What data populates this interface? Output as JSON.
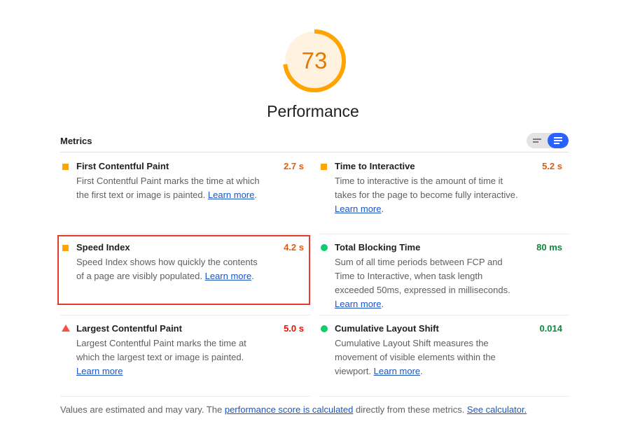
{
  "gauge": {
    "score": "73",
    "score_value": 73,
    "label": "Performance",
    "color": "#ffa400",
    "bg_color": "#fff3e0",
    "text_color": "#e67700"
  },
  "metrics": {
    "title": "Metrics",
    "toggle": {
      "left_icon": "compact-view-icon",
      "right_icon": "expanded-view-icon",
      "active": "expanded"
    },
    "items": [
      {
        "name": "First Contentful Paint",
        "value": "2.7 s",
        "status": "average",
        "icon": "orange-square-icon",
        "desc": "First Contentful Paint marks the time at which the first text or image is painted.",
        "link": "Learn more",
        "suffix": "."
      },
      {
        "name": "Time to Interactive",
        "value": "5.2 s",
        "status": "average",
        "icon": "orange-square-icon",
        "desc": "Time to interactive is the amount of time it takes for the page to become fully interactive.",
        "link": "Learn more",
        "suffix": "."
      },
      {
        "name": "Speed Index",
        "value": "4.2 s",
        "status": "average",
        "icon": "orange-square-icon",
        "desc": "Speed Index shows how quickly the contents of a page are visibly populated.",
        "link": "Learn more",
        "suffix": "."
      },
      {
        "name": "Total Blocking Time",
        "value": "80 ms",
        "status": "pass",
        "icon": "green-circle-icon",
        "desc": "Sum of all time periods between FCP and Time to Interactive, when task length exceeded 50ms, expressed in milliseconds.",
        "link": "Learn more",
        "suffix": "."
      },
      {
        "name": "Largest Contentful Paint",
        "value": "5.0 s",
        "status": "fail",
        "icon": "red-triangle-icon",
        "desc": "Largest Contentful Paint marks the time at which the largest text or image is painted.",
        "link": "Learn more",
        "suffix": ""
      },
      {
        "name": "Cumulative Layout Shift",
        "value": "0.014",
        "status": "pass",
        "icon": "green-circle-icon",
        "desc": "Cumulative Layout Shift measures the movement of visible elements within the viewport.",
        "link": "Learn more",
        "suffix": "."
      }
    ]
  },
  "footer": {
    "text1": "Values are estimated and may vary. The ",
    "link1": "performance score is calculated",
    "text2": " directly from these metrics. ",
    "link2": "See calculator."
  },
  "colors": {
    "average": "#ffa400",
    "pass": "#0cce6b",
    "fail": "#ff4e42",
    "link": "#1a55c4",
    "highlight": "#e53b2e",
    "toggle_active": "#2962ff"
  }
}
